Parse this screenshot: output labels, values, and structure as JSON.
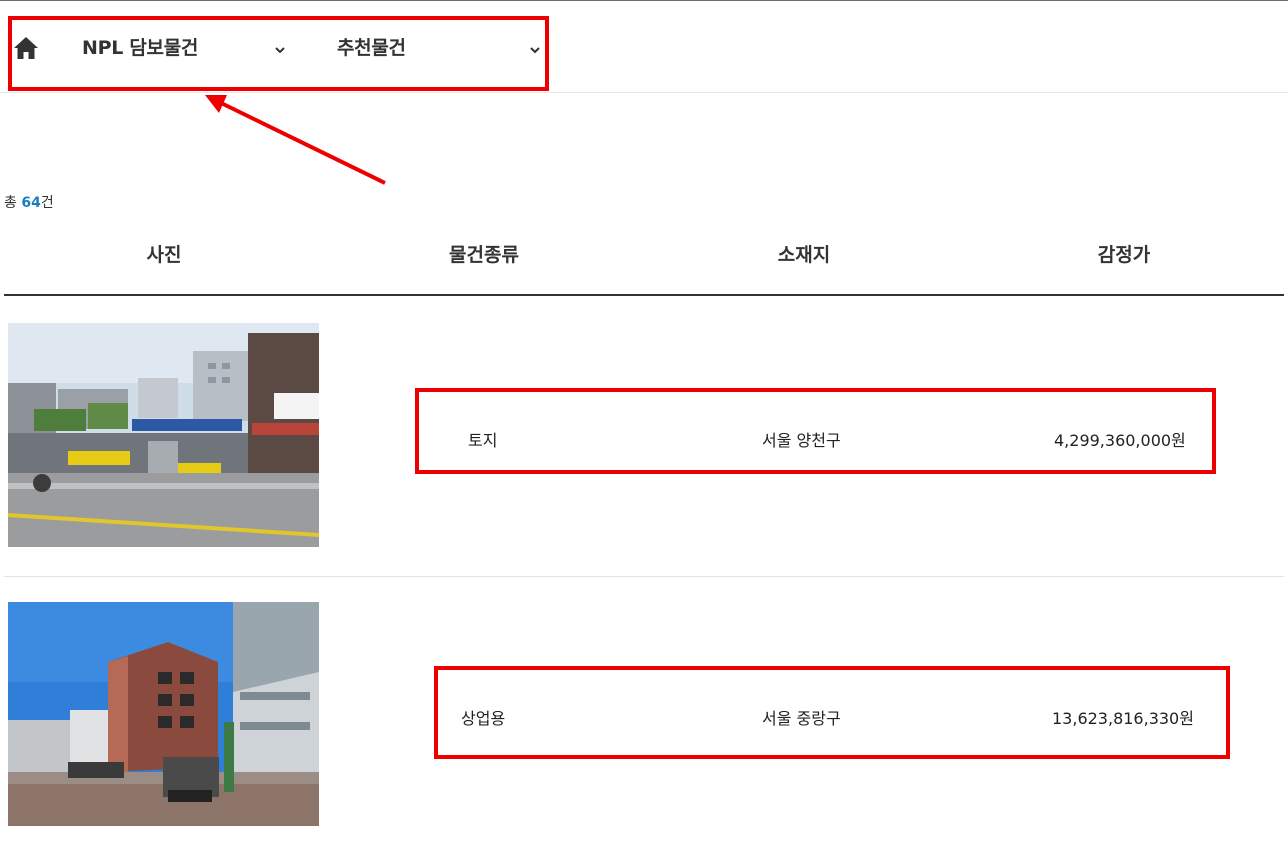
{
  "nav": {
    "home_icon": "home-icon",
    "menus": [
      {
        "label": "NPL 담보물건",
        "icon": "chevron-down-icon"
      },
      {
        "label": "추천물건",
        "icon": "chevron-down-icon"
      }
    ]
  },
  "summary": {
    "prefix": "총 ",
    "count": "64",
    "suffix": "건"
  },
  "table": {
    "headers": [
      "사진",
      "물건종류",
      "소재지",
      "감정가"
    ],
    "rows": [
      {
        "photo": "property-photo-land",
        "type": "토지",
        "location": "서울 양천구",
        "price": "4,299,360,000원"
      },
      {
        "photo": "property-photo-commercial-building",
        "type": "상업용",
        "location": "서울 중랑구",
        "price": "13,623,816,330원"
      }
    ]
  },
  "colors": {
    "accent": "#1a7fc1",
    "annotation": "#ee0000",
    "text": "#222222"
  }
}
